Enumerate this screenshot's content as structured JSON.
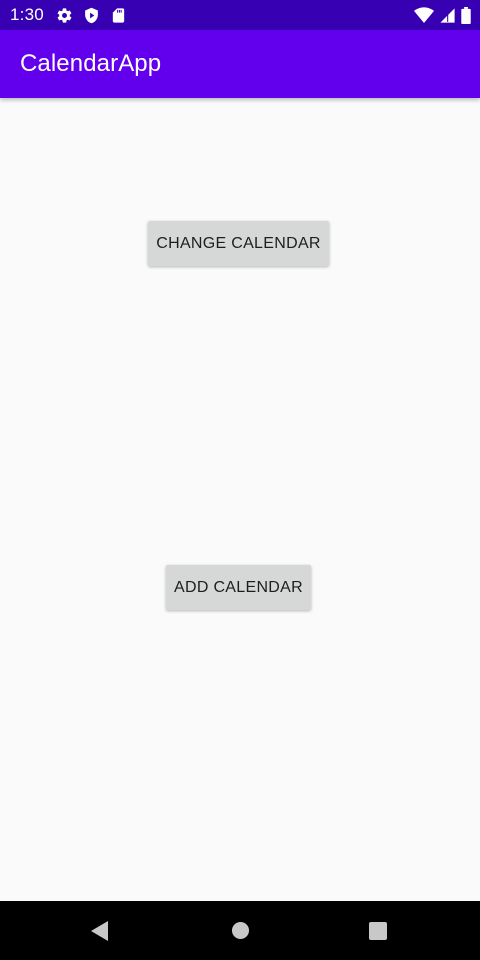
{
  "status_bar": {
    "time": "1:30",
    "left_icons": [
      "gear-icon",
      "shield-play-icon",
      "sd-card-icon"
    ],
    "right_icons": [
      "wifi-icon",
      "cell-signal-icon",
      "battery-icon"
    ],
    "background": "#3700b3"
  },
  "app_bar": {
    "title": "CalendarApp",
    "background": "#6200ee"
  },
  "main": {
    "change_calendar_label": "CHANGE CALENDAR",
    "add_calendar_label": "ADD CALENDAR",
    "button_background": "#d6d7d7"
  },
  "nav_bar": {
    "buttons": [
      "back-icon",
      "home-icon",
      "recents-icon"
    ],
    "background": "#000000"
  }
}
